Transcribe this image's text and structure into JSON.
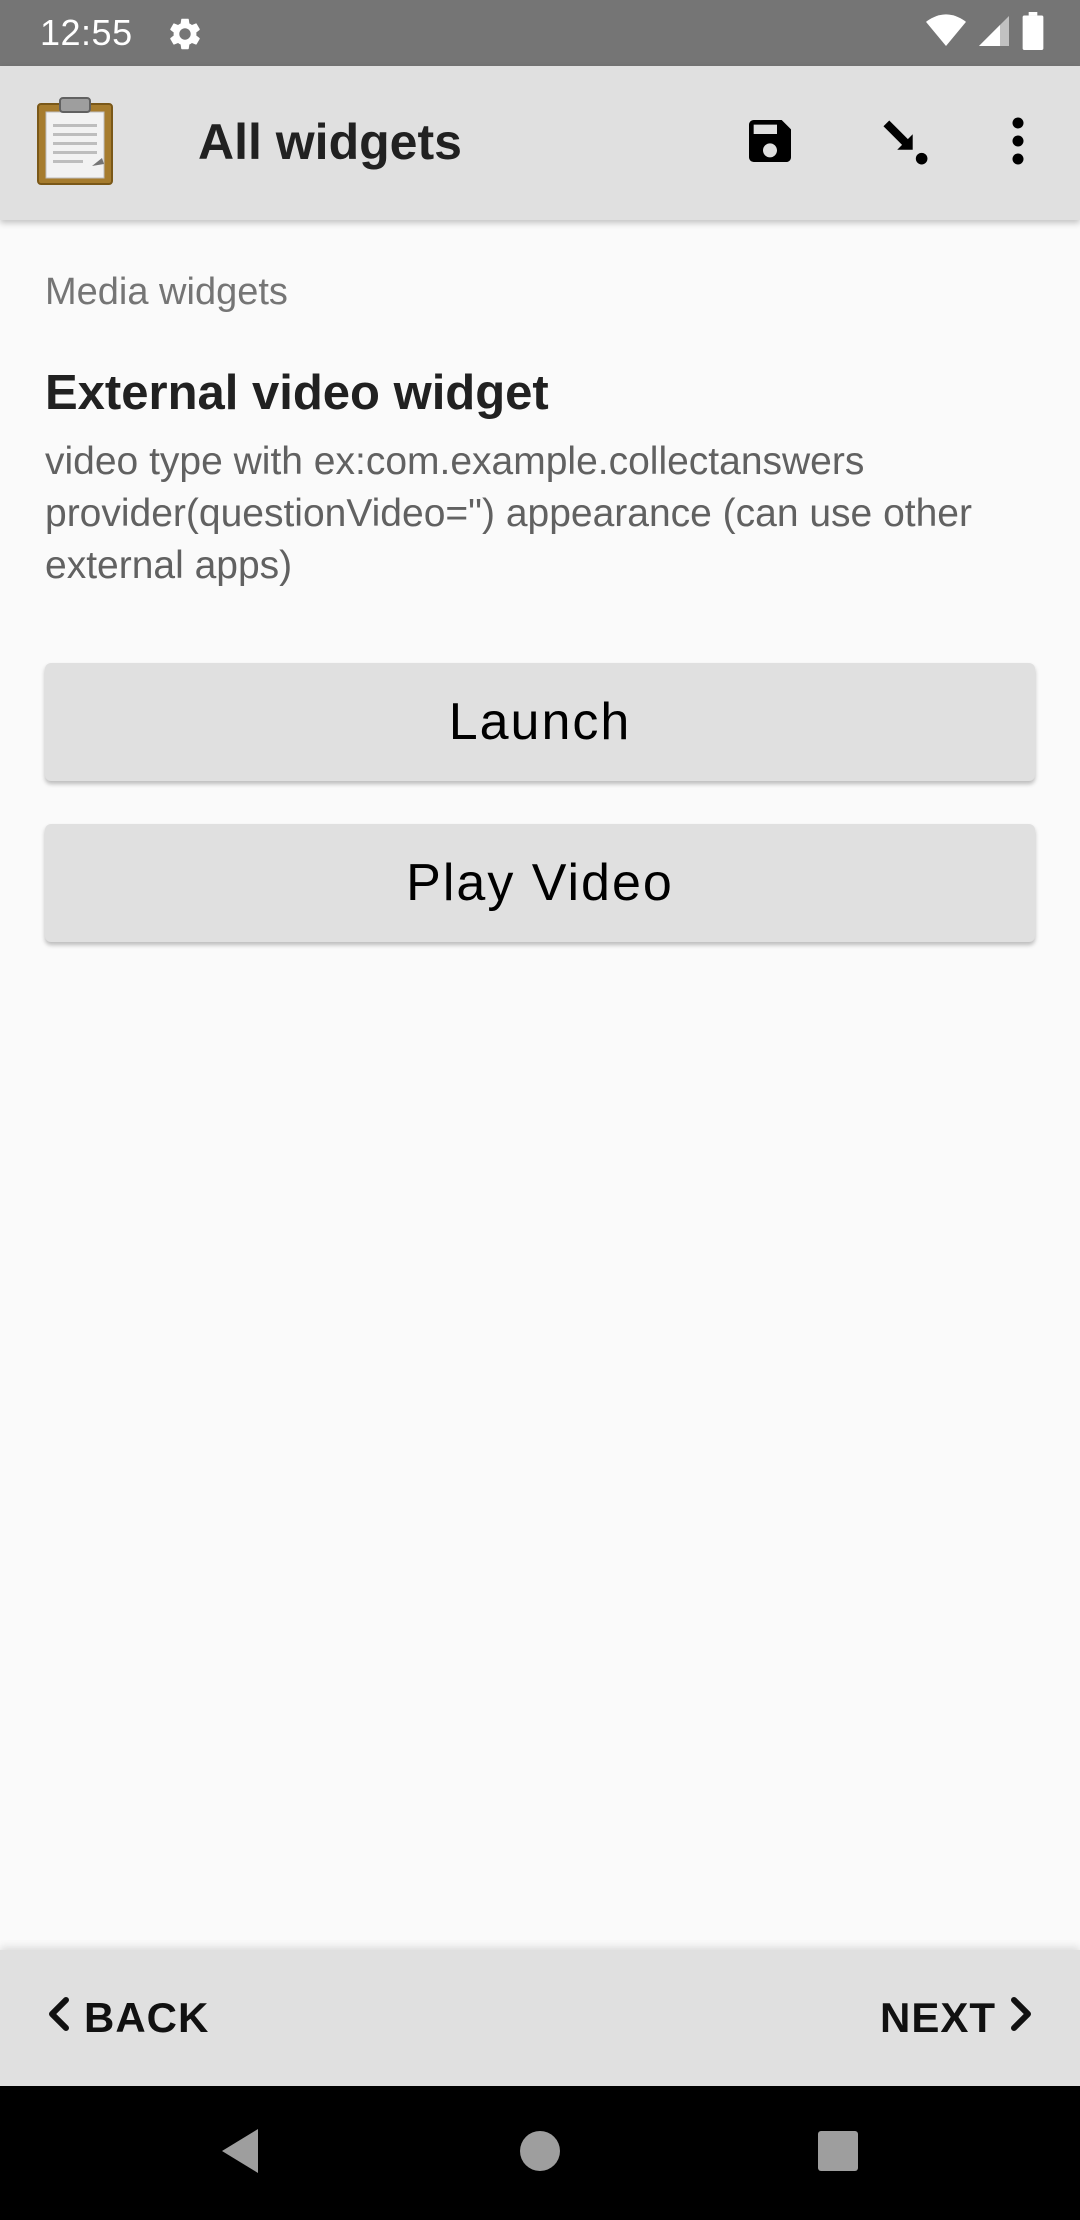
{
  "status_bar": {
    "time": "12:55",
    "icons": [
      "settings-gear-icon",
      "wifi-icon",
      "cell-signal-icon",
      "battery-icon"
    ]
  },
  "app_bar": {
    "title": "All widgets",
    "logo_icon": "clipboard-icon",
    "actions": [
      "save-icon",
      "jump-to-question-icon",
      "more-vert-icon"
    ]
  },
  "content": {
    "group_label": "Media widgets",
    "question_title": "External video widget",
    "question_hint": "video type with ex:com.example.collectanswers provider(questionVideo=\") appearance (can use other external apps)",
    "launch_label": "Launch",
    "play_video_label": "Play Video"
  },
  "nav": {
    "back_label": "BACK",
    "next_label": "NEXT"
  },
  "colors": {
    "status_bar": "#757575",
    "app_bar": "#e0e0e0",
    "background": "#fafafa",
    "button": "#e0e0e0",
    "system_nav": "#000000"
  }
}
